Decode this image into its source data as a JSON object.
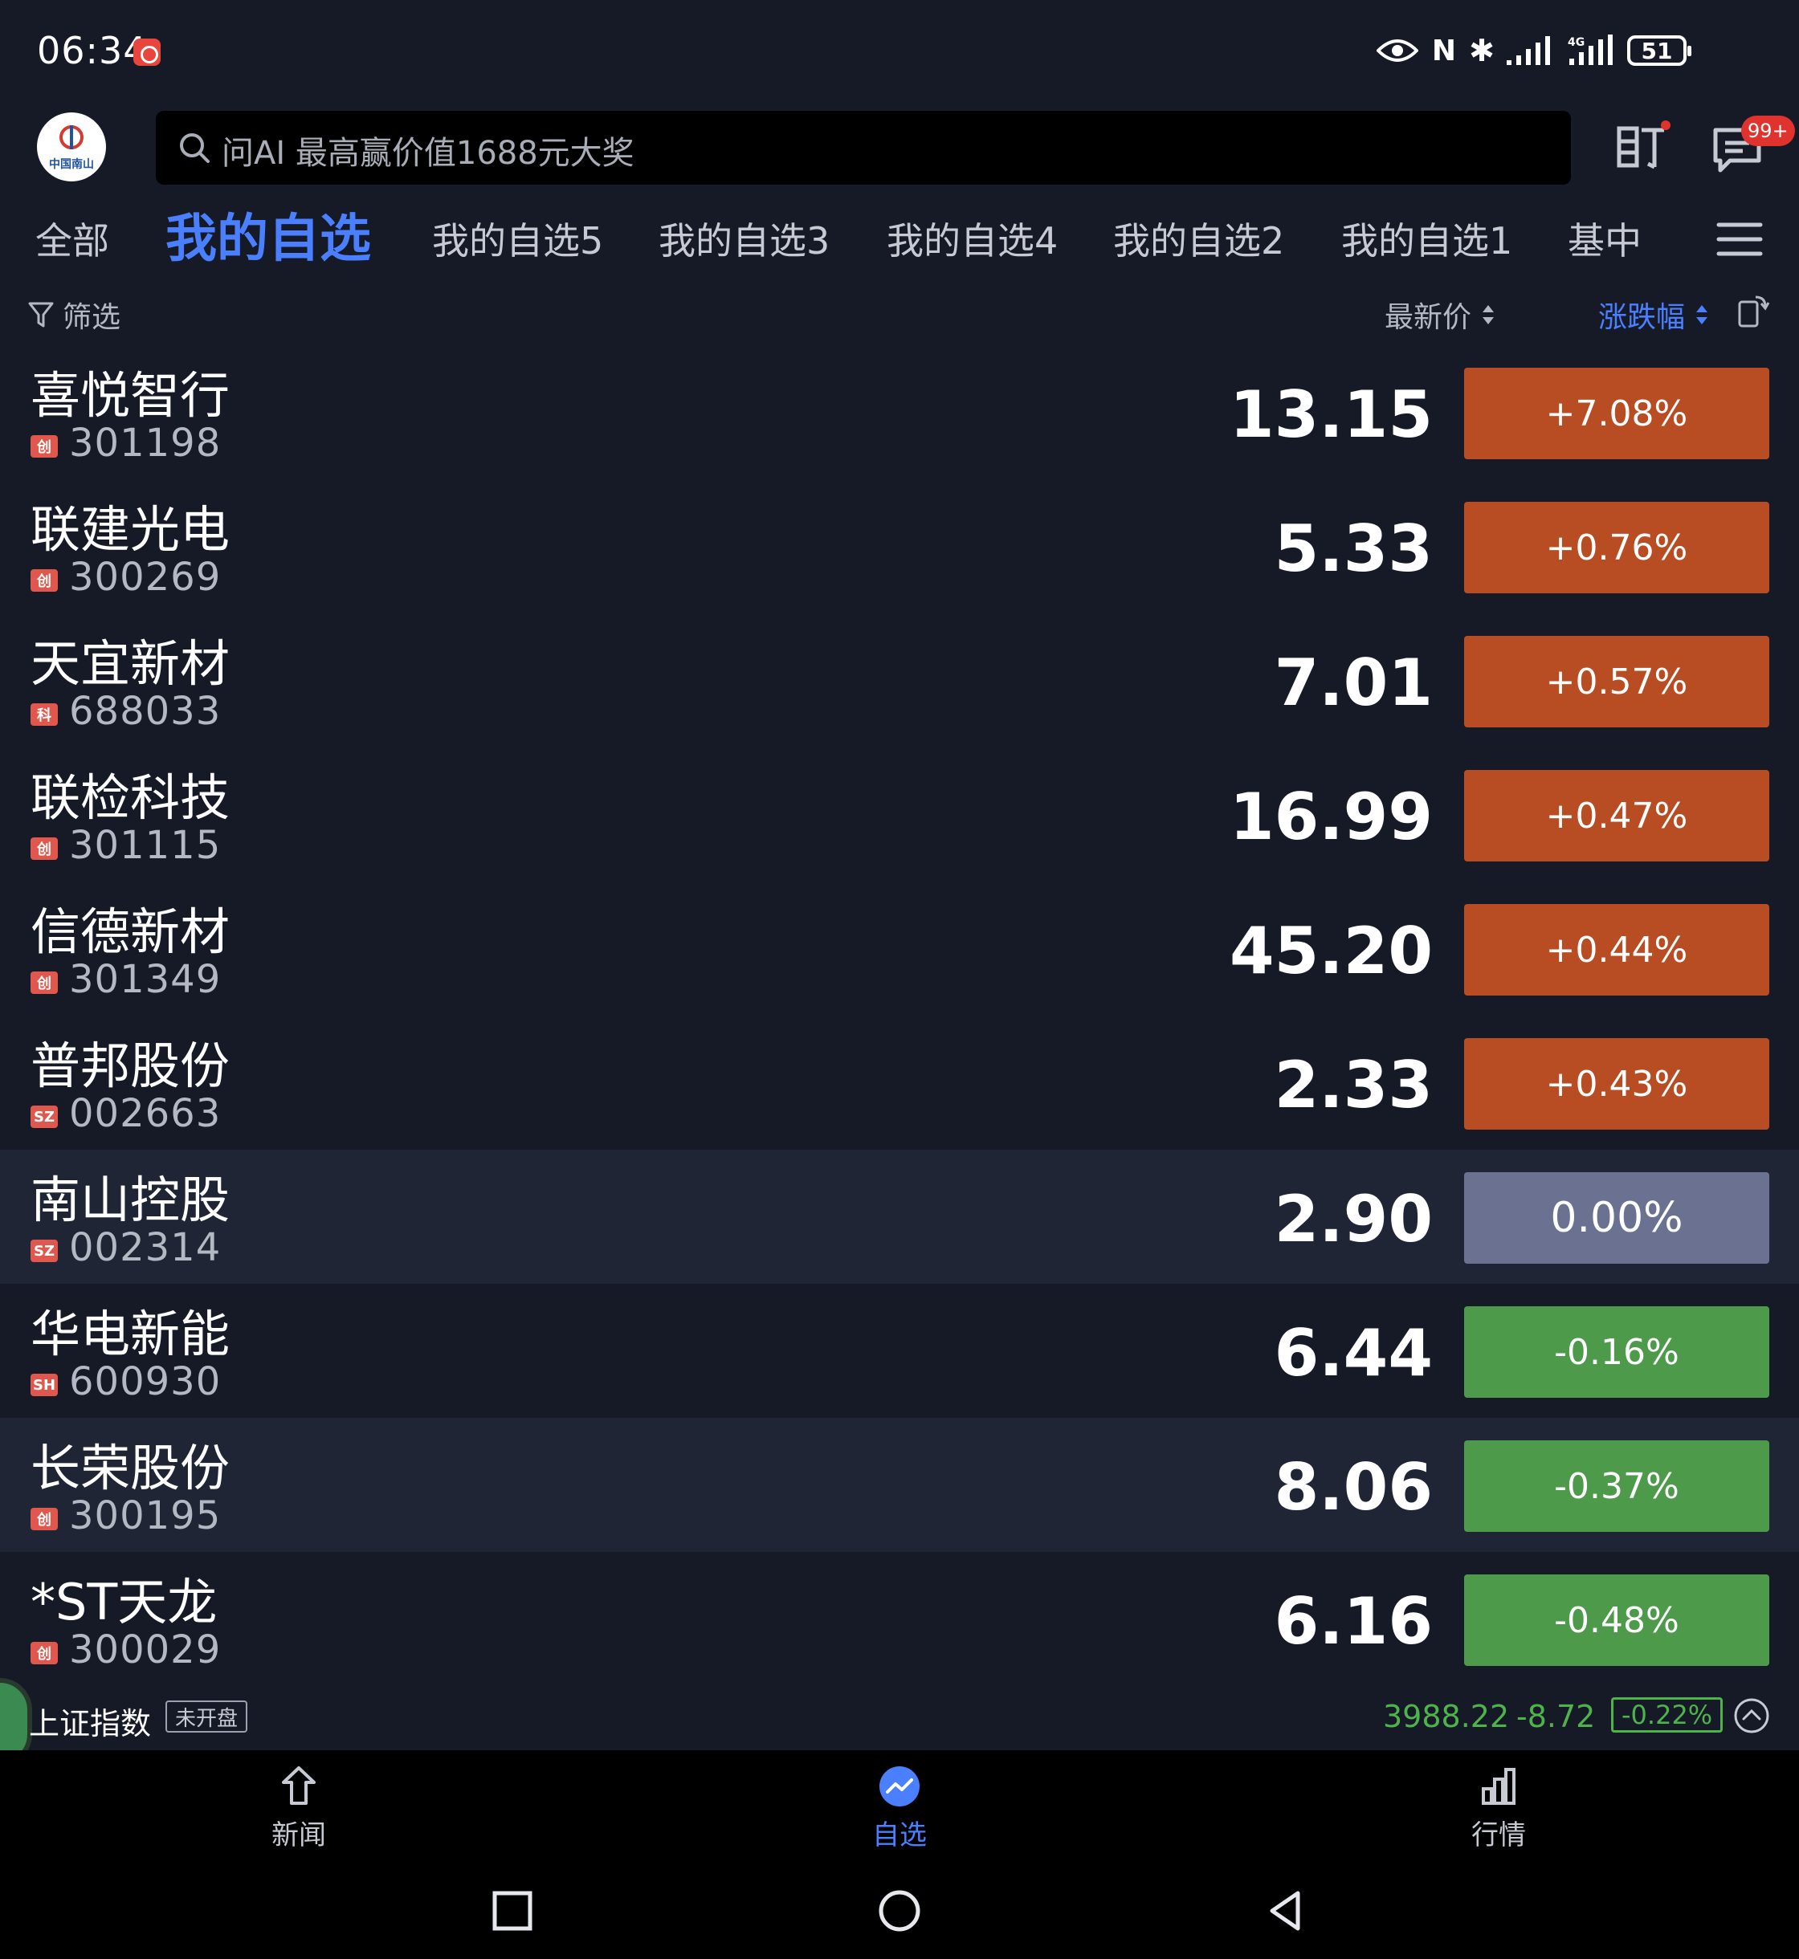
{
  "status_bar": {
    "time": "06:34",
    "nfc": "N",
    "bluetooth": "✱",
    "network": "4G",
    "battery": "51"
  },
  "header": {
    "logo_text": "中国南山",
    "search_placeholder": "问AI 最高赢价值1688元大奖",
    "message_badge": "99+"
  },
  "tabs": [
    {
      "label": "全部",
      "active": false
    },
    {
      "label": "我的自选",
      "active": true
    },
    {
      "label": "我的自选5",
      "active": false
    },
    {
      "label": "我的自选3",
      "active": false
    },
    {
      "label": "我的自选4",
      "active": false
    },
    {
      "label": "我的自选2",
      "active": false
    },
    {
      "label": "我的自选1",
      "active": false
    },
    {
      "label": "基中",
      "active": false
    }
  ],
  "columns": {
    "filter": "筛选",
    "price": "最新价",
    "change": "涨跌幅"
  },
  "stocks": [
    {
      "name": "喜悦智行",
      "tag": "创",
      "code": "301198",
      "price": "13.15",
      "change": "+7.08%",
      "trend": "up"
    },
    {
      "name": "联建光电",
      "tag": "创",
      "code": "300269",
      "price": "5.33",
      "change": "+0.76%",
      "trend": "up"
    },
    {
      "name": "天宜新材",
      "tag": "科",
      "code": "688033",
      "price": "7.01",
      "change": "+0.57%",
      "trend": "up"
    },
    {
      "name": "联检科技",
      "tag": "创",
      "code": "301115",
      "price": "16.99",
      "change": "+0.47%",
      "trend": "up"
    },
    {
      "name": "信德新材",
      "tag": "创",
      "code": "301349",
      "price": "45.20",
      "change": "+0.44%",
      "trend": "up"
    },
    {
      "name": "普邦股份",
      "tag": "SZ",
      "code": "002663",
      "price": "2.33",
      "change": "+0.43%",
      "trend": "up"
    },
    {
      "name": "南山控股",
      "tag": "SZ",
      "code": "002314",
      "price": "2.90",
      "change": "0.00%",
      "trend": "flat"
    },
    {
      "name": "华电新能",
      "tag": "SH",
      "code": "600930",
      "price": "6.44",
      "change": "-0.16%",
      "trend": "down"
    },
    {
      "name": "长荣股份",
      "tag": "创",
      "code": "300195",
      "price": "8.06",
      "change": "-0.37%",
      "trend": "down"
    },
    {
      "name": "*ST天龙",
      "tag": "创",
      "code": "300029",
      "price": "6.16",
      "change": "-0.48%",
      "trend": "down"
    }
  ],
  "index": {
    "name": "上证指数",
    "status": "未开盘",
    "value": "3988.22",
    "delta": "-8.72",
    "pct": "-0.22%"
  },
  "bottom_nav": [
    {
      "label": "新闻",
      "icon": "news-icon",
      "active": false
    },
    {
      "label": "自选",
      "icon": "watchlist-icon",
      "active": true
    },
    {
      "label": "行情",
      "icon": "market-icon",
      "active": false
    }
  ],
  "colors": {
    "background": "#161a27",
    "accent": "#4a7fff",
    "up": "#b84c23",
    "flat": "#6b7190",
    "down": "#4c9a4a",
    "green_text": "#4fb34c"
  }
}
